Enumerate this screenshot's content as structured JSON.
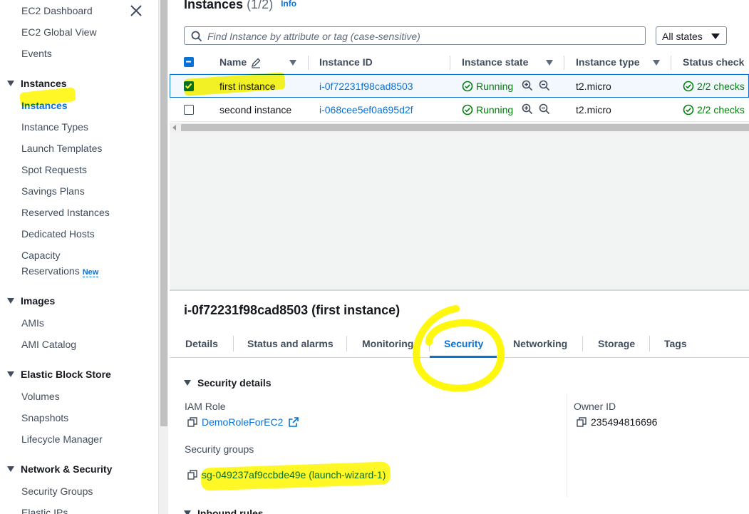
{
  "sidebar": {
    "top_items": [
      "EC2 Dashboard",
      "EC2 Global View",
      "Events"
    ],
    "sections": [
      {
        "title": "Instances",
        "items": [
          "Instances",
          "Instance Types",
          "Launch Templates",
          "Spot Requests",
          "Savings Plans",
          "Reserved Instances",
          "Dedicated Hosts",
          "Capacity",
          "Reservations"
        ],
        "badge": "New"
      },
      {
        "title": "Images",
        "items": [
          "AMIs",
          "AMI Catalog"
        ]
      },
      {
        "title": "Elastic Block Store",
        "items": [
          "Volumes",
          "Snapshots",
          "Lifecycle Manager"
        ]
      },
      {
        "title": "Network & Security",
        "items": [
          "Security Groups",
          "Elastic IPs"
        ]
      }
    ]
  },
  "header": {
    "title": "Instances",
    "count": "(1/2)",
    "info": "Info"
  },
  "search": {
    "placeholder": "Find Instance by attribute or tag (case-sensitive)"
  },
  "states_select": {
    "value": "All states"
  },
  "table": {
    "columns": [
      "Name",
      "Instance ID",
      "Instance state",
      "Instance type",
      "Status check"
    ],
    "rows": [
      {
        "name": "first instance",
        "id": "i-0f72231f98cad8503",
        "state": "Running",
        "type": "t2.micro",
        "status": "2/2 checks",
        "selected": true
      },
      {
        "name": "second instance",
        "id": "i-068cee5ef0a695d2f",
        "state": "Running",
        "type": "t2.micro",
        "status": "2/2 checks",
        "selected": false
      }
    ]
  },
  "detail": {
    "title": "i-0f72231f98cad8503 (first instance)",
    "tabs": [
      "Details",
      "Status and alarms",
      "Monitoring",
      "Security",
      "Networking",
      "Storage",
      "Tags"
    ],
    "active_tab": "Security",
    "section_title": "Security details",
    "iam_role_label": "IAM Role",
    "iam_role_value": "DemoRoleForEC2",
    "owner_label": "Owner ID",
    "owner_value": "235494816696",
    "sg_label": "Security groups",
    "sg_value": "sg-049237af9ccbde49e (launch-wizard-1)",
    "inbound_title": "Inbound rules"
  },
  "colors": {
    "link": "#0972d3",
    "running": "#037f0c",
    "highlight": "#fff700"
  }
}
